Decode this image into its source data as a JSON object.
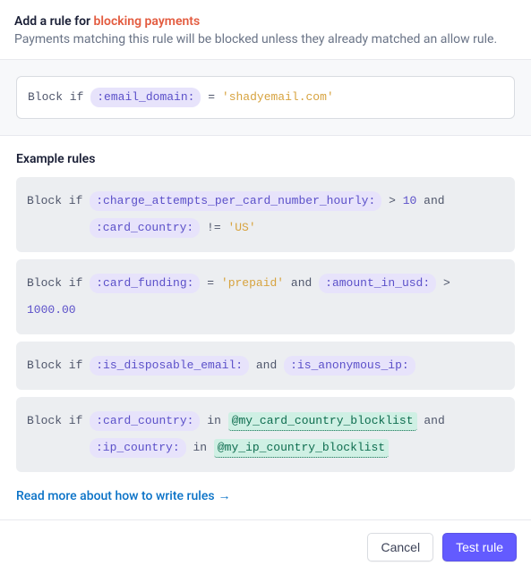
{
  "header": {
    "title_prefix": "Add a rule for ",
    "title_highlight": "blocking payments",
    "subtitle": "Payments matching this rule will be blocked unless they already matched an allow rule."
  },
  "editor": {
    "keyword": "Block if",
    "field": ":email_domain:",
    "operator": "=",
    "value": "'shadyemail.com'"
  },
  "examples": {
    "heading": "Example rules",
    "rules": [
      {
        "keyword": "Block if",
        "tokens_line1": [
          {
            "type": "field",
            "text": ":charge_attempts_per_card_number_hourly:"
          },
          {
            "type": "op",
            "text": ">"
          },
          {
            "type": "num",
            "text": "10"
          },
          {
            "type": "and",
            "text": "and"
          }
        ],
        "tokens_line2": [
          {
            "type": "field",
            "text": ":card_country:"
          },
          {
            "type": "op",
            "text": "!="
          },
          {
            "type": "str",
            "text": "'US'"
          }
        ]
      },
      {
        "keyword": "Block if",
        "tokens_line1": [
          {
            "type": "field",
            "text": ":card_funding:"
          },
          {
            "type": "op",
            "text": "="
          },
          {
            "type": "str",
            "text": "'prepaid'"
          },
          {
            "type": "and",
            "text": "and"
          },
          {
            "type": "field",
            "text": ":amount_in_usd:"
          },
          {
            "type": "op",
            "text": ">"
          },
          {
            "type": "num",
            "text": "1000.00"
          }
        ]
      },
      {
        "keyword": "Block if",
        "tokens_line1": [
          {
            "type": "field",
            "text": ":is_disposable_email:"
          },
          {
            "type": "and",
            "text": "and"
          },
          {
            "type": "field",
            "text": ":is_anonymous_ip:"
          }
        ]
      },
      {
        "keyword": "Block if",
        "tokens_line1": [
          {
            "type": "field",
            "text": ":card_country:"
          },
          {
            "type": "op",
            "text": "in"
          },
          {
            "type": "list",
            "text": "@my_card_country_blocklist"
          },
          {
            "type": "and",
            "text": "and"
          }
        ],
        "tokens_line2": [
          {
            "type": "field",
            "text": ":ip_country:"
          },
          {
            "type": "op",
            "text": "in"
          },
          {
            "type": "list",
            "text": "@my_ip_country_blocklist"
          }
        ]
      }
    ],
    "read_more": "Read more about how to write rules"
  },
  "footer": {
    "cancel": "Cancel",
    "test_rule": "Test rule"
  }
}
